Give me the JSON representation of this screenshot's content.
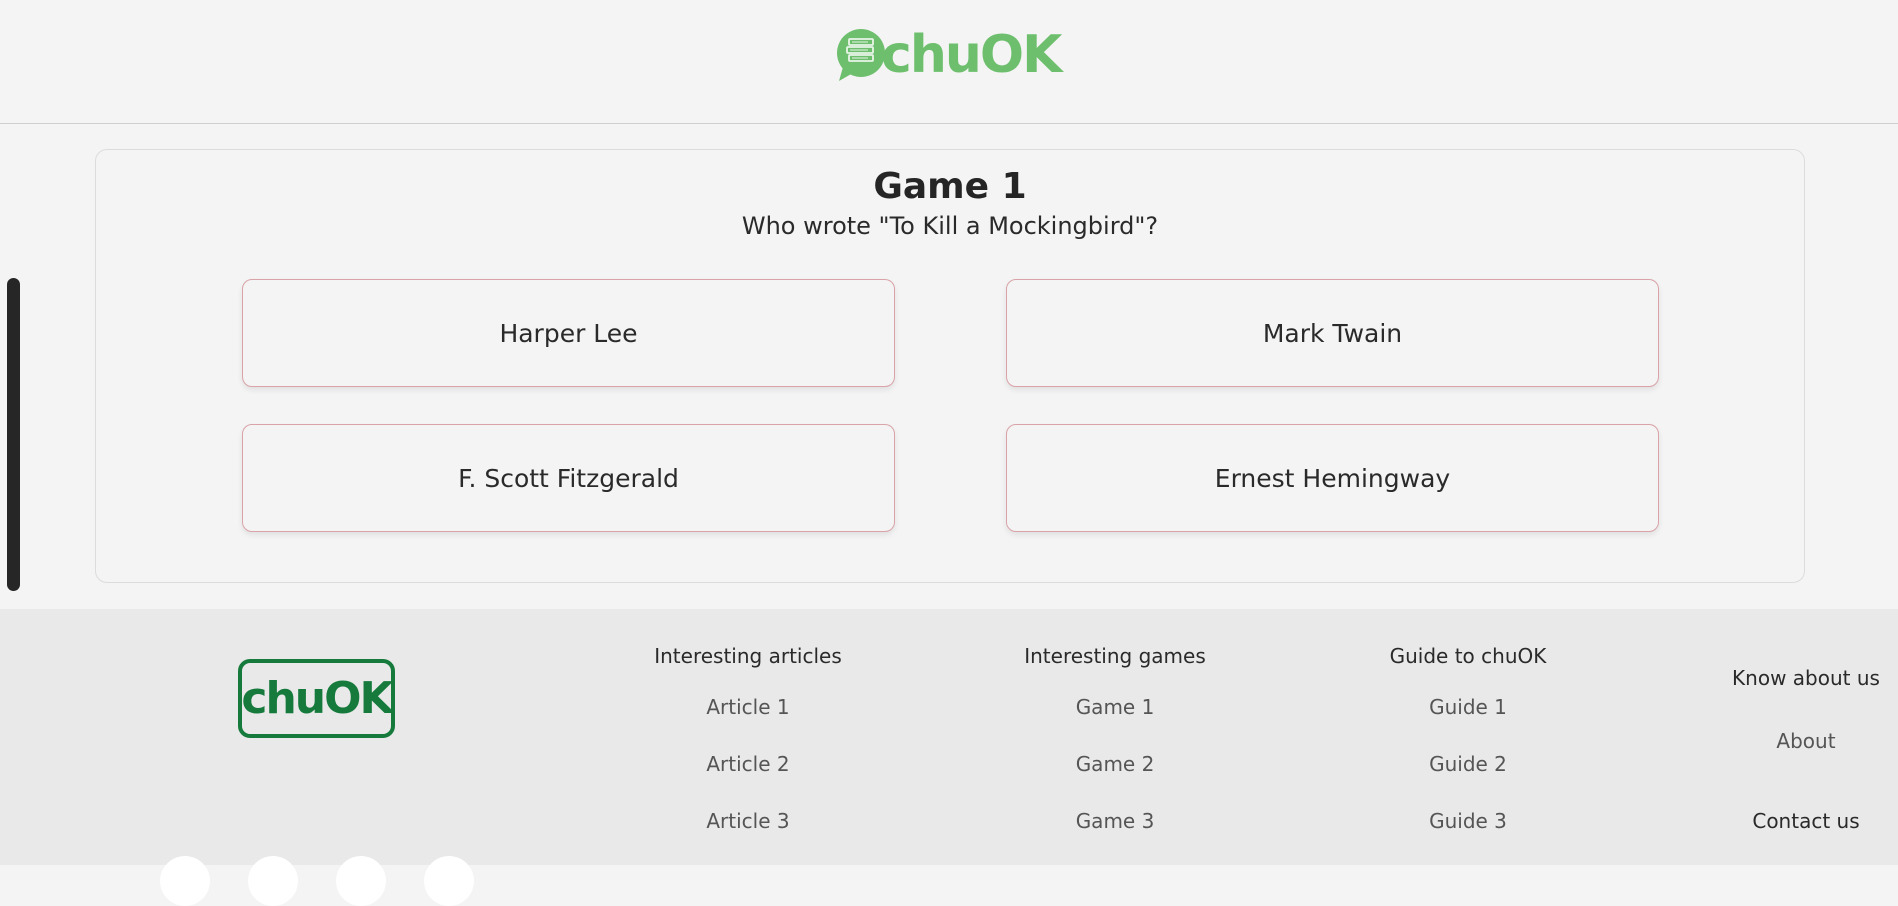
{
  "header": {
    "logo_text": "chuOK",
    "logo_icon": "chat-books-icon",
    "brand_color": "#6dbf6d"
  },
  "game": {
    "title": "Game 1",
    "question": "Who wrote \"To Kill a Mockingbird\"?",
    "answers": [
      "Harper Lee",
      "Mark Twain",
      "F. Scott Fitzgerald",
      "Ernest Hemingway"
    ],
    "answer_border_color": "#d9a3a8"
  },
  "footer": {
    "logo_text": "chuOK",
    "logo_color": "#157a3b",
    "columns": [
      {
        "heading": "Interesting articles",
        "links": [
          "Article 1",
          "Article 2",
          "Article 3"
        ]
      },
      {
        "heading": "Interesting games",
        "links": [
          "Game 1",
          "Game 2",
          "Game 3"
        ]
      },
      {
        "heading": "Guide to chuOK",
        "links": [
          "Guide 1",
          "Guide 2",
          "Guide 3"
        ]
      }
    ],
    "know_about": {
      "heading": "Know about us",
      "about": "About",
      "contact": "Contact us"
    },
    "social_icons": [
      "social-icon-1",
      "social-icon-2",
      "social-icon-3",
      "social-icon-4"
    ]
  }
}
